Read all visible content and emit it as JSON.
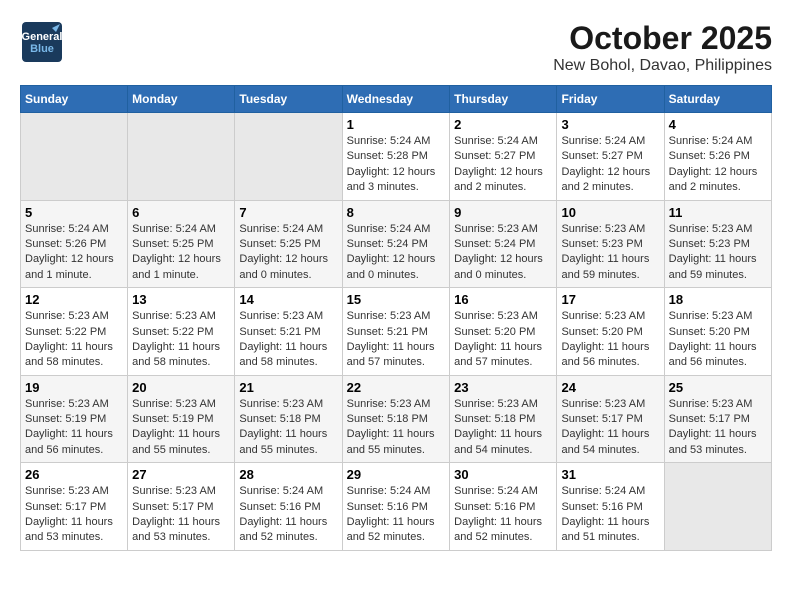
{
  "header": {
    "logo_line1": "General",
    "logo_line2": "Blue",
    "title": "October 2025",
    "subtitle": "New Bohol, Davao, Philippines"
  },
  "weekdays": [
    "Sunday",
    "Monday",
    "Tuesday",
    "Wednesday",
    "Thursday",
    "Friday",
    "Saturday"
  ],
  "weeks": [
    [
      {
        "day": "",
        "sunrise": "",
        "sunset": "",
        "daylight": "",
        "empty": true
      },
      {
        "day": "",
        "sunrise": "",
        "sunset": "",
        "daylight": "",
        "empty": true
      },
      {
        "day": "",
        "sunrise": "",
        "sunset": "",
        "daylight": "",
        "empty": true
      },
      {
        "day": "1",
        "sunrise": "Sunrise: 5:24 AM",
        "sunset": "Sunset: 5:28 PM",
        "daylight": "Daylight: 12 hours and 3 minutes."
      },
      {
        "day": "2",
        "sunrise": "Sunrise: 5:24 AM",
        "sunset": "Sunset: 5:27 PM",
        "daylight": "Daylight: 12 hours and 2 minutes."
      },
      {
        "day": "3",
        "sunrise": "Sunrise: 5:24 AM",
        "sunset": "Sunset: 5:27 PM",
        "daylight": "Daylight: 12 hours and 2 minutes."
      },
      {
        "day": "4",
        "sunrise": "Sunrise: 5:24 AM",
        "sunset": "Sunset: 5:26 PM",
        "daylight": "Daylight: 12 hours and 2 minutes."
      }
    ],
    [
      {
        "day": "5",
        "sunrise": "Sunrise: 5:24 AM",
        "sunset": "Sunset: 5:26 PM",
        "daylight": "Daylight: 12 hours and 1 minute."
      },
      {
        "day": "6",
        "sunrise": "Sunrise: 5:24 AM",
        "sunset": "Sunset: 5:25 PM",
        "daylight": "Daylight: 12 hours and 1 minute."
      },
      {
        "day": "7",
        "sunrise": "Sunrise: 5:24 AM",
        "sunset": "Sunset: 5:25 PM",
        "daylight": "Daylight: 12 hours and 0 minutes."
      },
      {
        "day": "8",
        "sunrise": "Sunrise: 5:24 AM",
        "sunset": "Sunset: 5:24 PM",
        "daylight": "Daylight: 12 hours and 0 minutes."
      },
      {
        "day": "9",
        "sunrise": "Sunrise: 5:23 AM",
        "sunset": "Sunset: 5:24 PM",
        "daylight": "Daylight: 12 hours and 0 minutes."
      },
      {
        "day": "10",
        "sunrise": "Sunrise: 5:23 AM",
        "sunset": "Sunset: 5:23 PM",
        "daylight": "Daylight: 11 hours and 59 minutes."
      },
      {
        "day": "11",
        "sunrise": "Sunrise: 5:23 AM",
        "sunset": "Sunset: 5:23 PM",
        "daylight": "Daylight: 11 hours and 59 minutes."
      }
    ],
    [
      {
        "day": "12",
        "sunrise": "Sunrise: 5:23 AM",
        "sunset": "Sunset: 5:22 PM",
        "daylight": "Daylight: 11 hours and 58 minutes."
      },
      {
        "day": "13",
        "sunrise": "Sunrise: 5:23 AM",
        "sunset": "Sunset: 5:22 PM",
        "daylight": "Daylight: 11 hours and 58 minutes."
      },
      {
        "day": "14",
        "sunrise": "Sunrise: 5:23 AM",
        "sunset": "Sunset: 5:21 PM",
        "daylight": "Daylight: 11 hours and 58 minutes."
      },
      {
        "day": "15",
        "sunrise": "Sunrise: 5:23 AM",
        "sunset": "Sunset: 5:21 PM",
        "daylight": "Daylight: 11 hours and 57 minutes."
      },
      {
        "day": "16",
        "sunrise": "Sunrise: 5:23 AM",
        "sunset": "Sunset: 5:20 PM",
        "daylight": "Daylight: 11 hours and 57 minutes."
      },
      {
        "day": "17",
        "sunrise": "Sunrise: 5:23 AM",
        "sunset": "Sunset: 5:20 PM",
        "daylight": "Daylight: 11 hours and 56 minutes."
      },
      {
        "day": "18",
        "sunrise": "Sunrise: 5:23 AM",
        "sunset": "Sunset: 5:20 PM",
        "daylight": "Daylight: 11 hours and 56 minutes."
      }
    ],
    [
      {
        "day": "19",
        "sunrise": "Sunrise: 5:23 AM",
        "sunset": "Sunset: 5:19 PM",
        "daylight": "Daylight: 11 hours and 56 minutes."
      },
      {
        "day": "20",
        "sunrise": "Sunrise: 5:23 AM",
        "sunset": "Sunset: 5:19 PM",
        "daylight": "Daylight: 11 hours and 55 minutes."
      },
      {
        "day": "21",
        "sunrise": "Sunrise: 5:23 AM",
        "sunset": "Sunset: 5:18 PM",
        "daylight": "Daylight: 11 hours and 55 minutes."
      },
      {
        "day": "22",
        "sunrise": "Sunrise: 5:23 AM",
        "sunset": "Sunset: 5:18 PM",
        "daylight": "Daylight: 11 hours and 55 minutes."
      },
      {
        "day": "23",
        "sunrise": "Sunrise: 5:23 AM",
        "sunset": "Sunset: 5:18 PM",
        "daylight": "Daylight: 11 hours and 54 minutes."
      },
      {
        "day": "24",
        "sunrise": "Sunrise: 5:23 AM",
        "sunset": "Sunset: 5:17 PM",
        "daylight": "Daylight: 11 hours and 54 minutes."
      },
      {
        "day": "25",
        "sunrise": "Sunrise: 5:23 AM",
        "sunset": "Sunset: 5:17 PM",
        "daylight": "Daylight: 11 hours and 53 minutes."
      }
    ],
    [
      {
        "day": "26",
        "sunrise": "Sunrise: 5:23 AM",
        "sunset": "Sunset: 5:17 PM",
        "daylight": "Daylight: 11 hours and 53 minutes."
      },
      {
        "day": "27",
        "sunrise": "Sunrise: 5:23 AM",
        "sunset": "Sunset: 5:17 PM",
        "daylight": "Daylight: 11 hours and 53 minutes."
      },
      {
        "day": "28",
        "sunrise": "Sunrise: 5:24 AM",
        "sunset": "Sunset: 5:16 PM",
        "daylight": "Daylight: 11 hours and 52 minutes."
      },
      {
        "day": "29",
        "sunrise": "Sunrise: 5:24 AM",
        "sunset": "Sunset: 5:16 PM",
        "daylight": "Daylight: 11 hours and 52 minutes."
      },
      {
        "day": "30",
        "sunrise": "Sunrise: 5:24 AM",
        "sunset": "Sunset: 5:16 PM",
        "daylight": "Daylight: 11 hours and 52 minutes."
      },
      {
        "day": "31",
        "sunrise": "Sunrise: 5:24 AM",
        "sunset": "Sunset: 5:16 PM",
        "daylight": "Daylight: 11 hours and 51 minutes."
      },
      {
        "day": "",
        "sunrise": "",
        "sunset": "",
        "daylight": "",
        "empty": true
      }
    ]
  ]
}
